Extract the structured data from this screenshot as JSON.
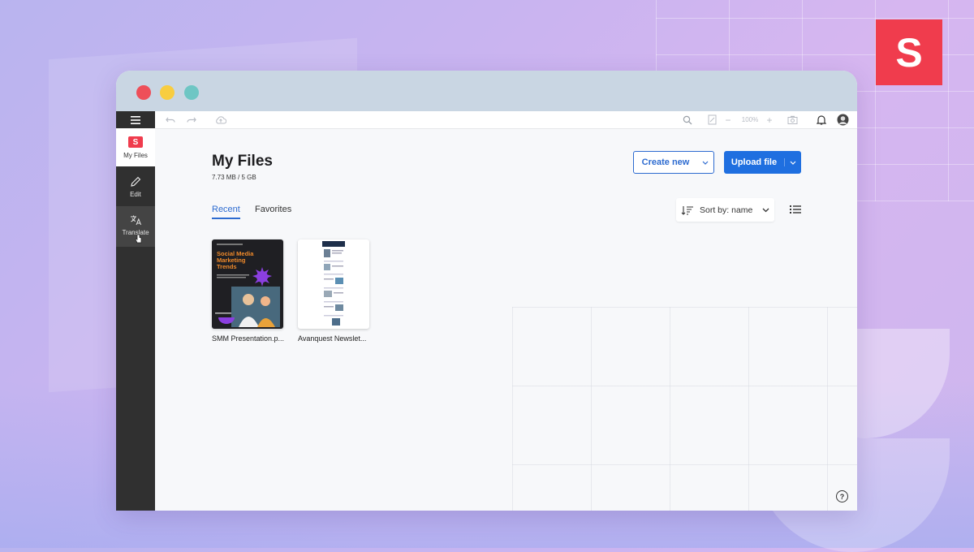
{
  "brand": {
    "logo_letter": "S",
    "accent": "#f03c4d"
  },
  "window": {
    "controls": [
      "close",
      "minimize",
      "maximize"
    ],
    "toolbar": {
      "zoom": "100%",
      "icons": [
        "menu-icon",
        "undo-icon",
        "redo-icon",
        "cloud-upload-icon",
        "search-icon",
        "page-icon",
        "zoom-out-icon",
        "zoom-in-icon",
        "camera-icon",
        "bell-icon",
        "avatar"
      ]
    }
  },
  "sidebar": {
    "items": [
      {
        "label": "My Files",
        "icon": "logo-icon"
      },
      {
        "label": "Edit",
        "icon": "pencil-icon"
      },
      {
        "label": "Translate",
        "icon": "translate-icon"
      }
    ]
  },
  "main": {
    "title": "My Files",
    "storage": "7.73 MB / 5 GB",
    "create_label": "Create new",
    "upload_label": "Upload file",
    "tabs": [
      {
        "label": "Recent",
        "active": true
      },
      {
        "label": "Favorites",
        "active": false
      }
    ],
    "sort_label": "Sort by: name",
    "files": [
      {
        "name": "SMM Presentation.p...",
        "thumb_title": "Social Media Marketing Trends"
      },
      {
        "name": "Avanquest Newslet..."
      }
    ]
  },
  "colors": {
    "primary": "#1f6fe0",
    "sidebar_bg": "#303030",
    "titlebar": "#c9d6e3"
  }
}
